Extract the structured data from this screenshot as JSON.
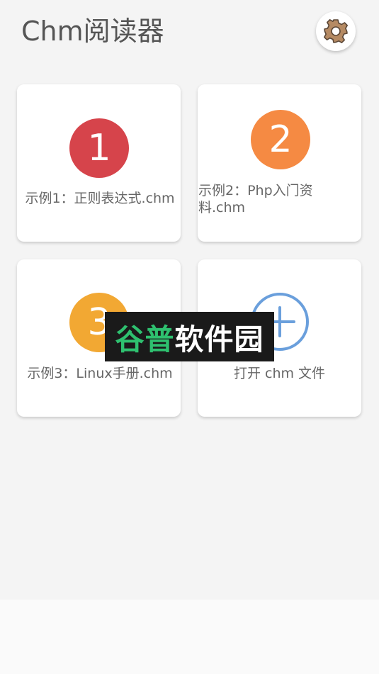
{
  "app": {
    "title": "Chm阅读器",
    "settings_icon": "gear-icon"
  },
  "cards": [
    {
      "badge": "1",
      "badge_color": "#d6444b",
      "label": "示例1：正则表达式.chm"
    },
    {
      "badge": "2",
      "badge_color": "#f58a43",
      "label_line1": "示例2：Php入门资",
      "label_line2": "料.chm"
    },
    {
      "badge": "3",
      "badge_color": "#f2a833",
      "label": "示例3：Linux手册.chm"
    },
    {
      "icon": "plus-circle-icon",
      "icon_color": "#6a9fdc",
      "label": "打开 chm 文件"
    }
  ],
  "watermark": {
    "part1": "谷普",
    "part2": "软件园"
  }
}
